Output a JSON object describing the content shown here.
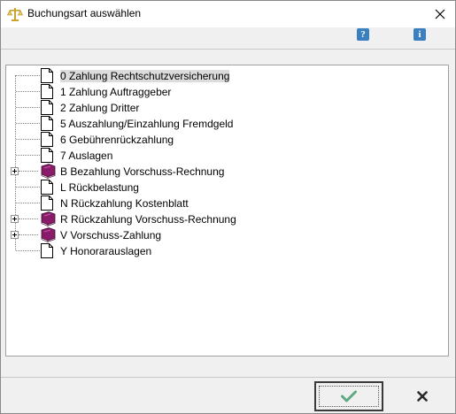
{
  "window": {
    "title": "Buchungsart auswählen",
    "icon": "scales-icon"
  },
  "toolbar": {
    "help_icon": "help-icon",
    "info_icon": "info-icon",
    "help_glyph": "?",
    "info_glyph": "i"
  },
  "tree": {
    "items": [
      {
        "label": "0 Zahlung Rechtschutzversicherung",
        "icon": "document-icon",
        "expandable": false,
        "selected": true
      },
      {
        "label": "1 Zahlung Auftraggeber",
        "icon": "document-icon",
        "expandable": false
      },
      {
        "label": "2 Zahlung Dritter",
        "icon": "document-icon",
        "expandable": false
      },
      {
        "label": "5 Auszahlung/Einzahlung Fremdgeld",
        "icon": "document-icon",
        "expandable": false
      },
      {
        "label": "6 Gebührenrückzahlung",
        "icon": "document-icon",
        "expandable": false
      },
      {
        "label": "7 Auslagen",
        "icon": "document-icon",
        "expandable": false
      },
      {
        "label": "B Bezahlung Vorschuss-Rechnung",
        "icon": "book-icon",
        "expandable": true
      },
      {
        "label": "L Rückbelastung",
        "icon": "document-icon",
        "expandable": false
      },
      {
        "label": "N Rückzahlung Kostenblatt",
        "icon": "document-icon",
        "expandable": false
      },
      {
        "label": "R Rückzahlung Vorschuss-Rechnung",
        "icon": "book-icon",
        "expandable": true
      },
      {
        "label": "V Vorschuss-Zahlung",
        "icon": "book-icon",
        "expandable": true
      },
      {
        "label": "Y Honorarauslagen",
        "icon": "document-icon",
        "expandable": false
      }
    ]
  },
  "buttons": {
    "ok_icon": "checkmark-icon",
    "cancel_icon": "close-x-icon"
  },
  "colors": {
    "ok_green": "#5fa882",
    "book_purple": "#8a1a6a",
    "toolbar_blue": "#3a7fbf"
  }
}
